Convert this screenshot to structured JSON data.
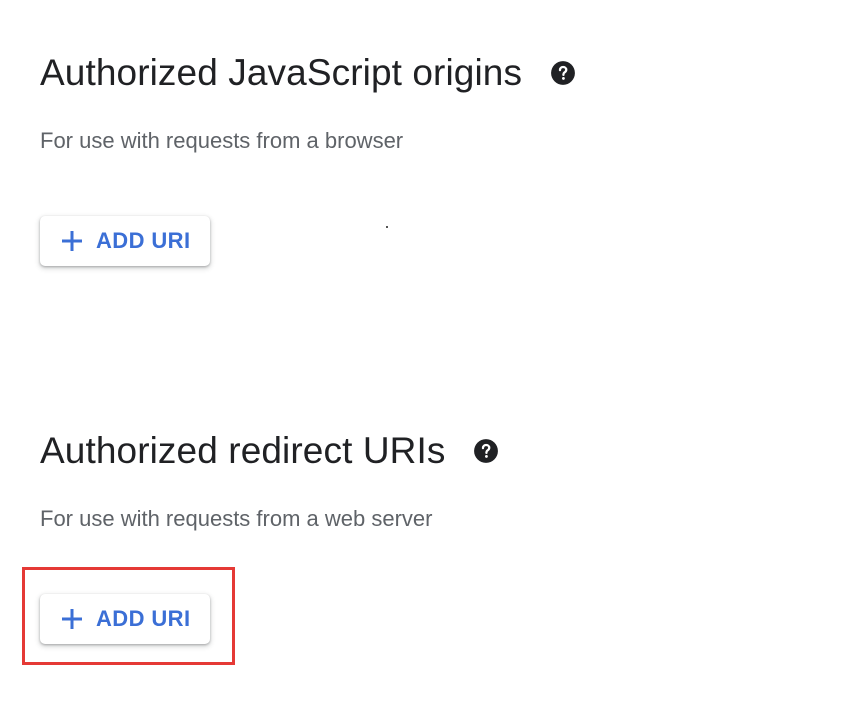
{
  "js_origins": {
    "title": "Authorized JavaScript origins",
    "help_icon": "help-circle-icon",
    "description": "For use with requests from a browser",
    "add_button_label": "ADD URI",
    "add_button_icon": "plus-icon"
  },
  "redirect_uris": {
    "title": "Authorized redirect URIs",
    "help_icon": "help-circle-icon",
    "description": "For use with requests from a web server",
    "add_button_label": "ADD URI",
    "add_button_icon": "plus-icon"
  },
  "colors": {
    "heading": "#202124",
    "description": "#5f6368",
    "button_text": "#3b6fd6",
    "highlight": "#e53935"
  }
}
